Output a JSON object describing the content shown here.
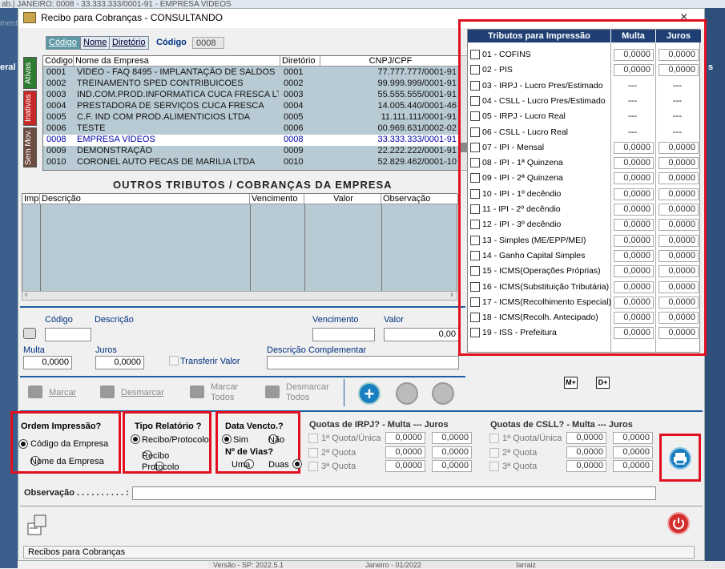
{
  "background": {
    "strip_text": "ab.| JANEIRO: 0008 - 33.333.333/0001-91 - EMPRESA VÍDEOS",
    "left_label": "eral",
    "left_label2": "mento",
    "right_label": "s"
  },
  "window": {
    "title": "Recibo para Cobranças - CONSULTANDO",
    "close_symbol": "×"
  },
  "tabs": [
    {
      "label": "Código"
    },
    {
      "label": "Nome"
    },
    {
      "label": "Diretório"
    }
  ],
  "codigo": {
    "label": "Código",
    "value": "0008"
  },
  "side_tabs": [
    {
      "label": "Ativas",
      "color": "#2e7d32"
    },
    {
      "label": "Inativas",
      "color": "#c62828"
    },
    {
      "label": "Sem Mov.",
      "color": "#6d4c41"
    }
  ],
  "company_grid": {
    "headers": [
      "Código",
      "Nome da Empresa",
      "Diretório",
      "CNPJ/CPF"
    ],
    "rows": [
      {
        "codigo": "0001",
        "nome": "VÍDEO - FAQ 8495 - IMPLANTAÇÃO DE SALDOS",
        "dir": "0001",
        "cnpj": "77.777.777/0001-91"
      },
      {
        "codigo": "0002",
        "nome": "TREINAMENTO SPED CONTRIBUICOES",
        "dir": "0002",
        "cnpj": "99.999.999/0001-91"
      },
      {
        "codigo": "0003",
        "nome": "IND.COM.PROD.INFORMATICA CUCA FRESCA LTD",
        "dir": "0003",
        "cnpj": "55.555.555/0001-91"
      },
      {
        "codigo": "0004",
        "nome": "PRESTADORA DE SERVIÇOS CUCA FRESCA",
        "dir": "0004",
        "cnpj": "14.005.440/0001-46"
      },
      {
        "codigo": "0005",
        "nome": "C.F. IND COM PROD.ALIMENTICIOS LTDA",
        "dir": "0005",
        "cnpj": "11.111.111/0001-91"
      },
      {
        "codigo": "0006",
        "nome": "TESTE",
        "dir": "0006",
        "cnpj": "00.969.631/0002-02"
      },
      {
        "codigo": "0008",
        "nome": "EMPRESA VÍDEOS",
        "dir": "0008",
        "cnpj": "33.333.333/0001-91"
      },
      {
        "codigo": "0009",
        "nome": "DEMONSTRAÇÃO",
        "dir": "0009",
        "cnpj": "22.222.222/0001-91"
      },
      {
        "codigo": "0010",
        "nome": "CORONEL AUTO PECAS DE MARILIA LTDA",
        "dir": "0010",
        "cnpj": "52.829.462/0001-10"
      }
    ],
    "selected_index": 6
  },
  "outros": {
    "title": "OUTROS  TRIBUTOS / COBRANÇAS  DA  EMPRESA",
    "headers": [
      "Imp.",
      "Descrição",
      "Vencimento",
      "Valor",
      "Observação"
    ]
  },
  "form": {
    "codigo_label": "Código",
    "descricao_label": "Descrição",
    "vencimento_label": "Vencimento",
    "valor_label": "Valor",
    "valor_value": "0,00",
    "multa_label": "Multa",
    "multa_value": "0,0000",
    "juros_label": "Juros",
    "juros_value": "0,0000",
    "transferir_label": "Transferir Valor",
    "desc_comp_label": "Descrição Complementar"
  },
  "actions": {
    "marcar": "Marcar",
    "desmarcar": "Desmarcar",
    "marcar_todos_1": "Marcar",
    "marcar_todos_2": "Todos",
    "desmarcar_todos_1": "Desmarcar",
    "desmarcar_todos_2": "Todos",
    "add_symbol": "+"
  },
  "ordem": {
    "title": "Ordem Impressão?",
    "options": [
      "Código da Empresa",
      "Nome da Empresa"
    ],
    "selected": 0
  },
  "tipo": {
    "title": "Tipo Relatório ?",
    "options": [
      "Recibo/Protocolo",
      "Recibo",
      "Protocolo"
    ],
    "selected": 0
  },
  "data_vencto": {
    "title": "Data Vencto.?",
    "options": [
      "Sim",
      "Não"
    ],
    "selected": 0,
    "vias_title": "Nº de Vias?",
    "vias_options": [
      "Uma",
      "Duas"
    ],
    "vias_selected": 1
  },
  "irpj": {
    "title": "Quotas de IRPJ? -  Multa  ---  Juros",
    "rows": [
      {
        "label": "1ª Quota/Única",
        "multa": "0,0000",
        "juros": "0,0000"
      },
      {
        "label": "2ª Quota",
        "multa": "0,0000",
        "juros": "0,0000"
      },
      {
        "label": "3ª Quota",
        "multa": "0,0000",
        "juros": "0,0000"
      }
    ]
  },
  "csll": {
    "title": "Quotas de CSLL? - Multa  --- Juros",
    "rows": [
      {
        "label": "1ª Quota/Única",
        "multa": "0,0000",
        "juros": "0,0000"
      },
      {
        "label": "2ª Quota",
        "multa": "0,0000",
        "juros": "0,0000"
      },
      {
        "label": "3ª Quota",
        "multa": "0,0000",
        "juros": "0,0000"
      }
    ]
  },
  "observacao": {
    "label": "Observação . . . . . . . . . . :"
  },
  "status": {
    "text": "Recibos para Cobranças"
  },
  "bottom_strip": [
    "Versão - SP: 2022.5.1",
    "Janeiro - 01/2022",
    "Iarraiz"
  ],
  "tributos": {
    "headers": [
      "Tributos para Impressão",
      "Multa",
      "Juros"
    ],
    "rows": [
      {
        "label": "01 - COFINS",
        "multa": "0,0000",
        "juros": "0,0000"
      },
      {
        "label": "02 - PIS",
        "multa": "0,0000",
        "juros": "0,0000"
      },
      {
        "label": "03 - IRPJ   -  Lucro Pres/Estimado",
        "multa": "---",
        "juros": "---"
      },
      {
        "label": "04 - CSLL - Lucro Pres/Estimado",
        "multa": "---",
        "juros": "---"
      },
      {
        "label": "05 - IRPJ   -  Lucro Real",
        "multa": "---",
        "juros": "---"
      },
      {
        "label": "06 - CSLL - Lucro Real",
        "multa": "---",
        "juros": "---"
      },
      {
        "label": "07 - IPI  -  Mensal",
        "multa": "0,0000",
        "juros": "0,0000"
      },
      {
        "label": "08 - IPI  -  1ª Quinzena",
        "multa": "0,0000",
        "juros": "0,0000"
      },
      {
        "label": "09 - IPI  -  2ª Quinzena",
        "multa": "0,0000",
        "juros": "0,0000"
      },
      {
        "label": "10 - IPI  -  1º decêndio",
        "multa": "0,0000",
        "juros": "0,0000"
      },
      {
        "label": "11 - IPI  -  2º decêndio",
        "multa": "0,0000",
        "juros": "0,0000"
      },
      {
        "label": "12 - IPI  -  3º decêndio",
        "multa": "0,0000",
        "juros": "0,0000"
      },
      {
        "label": "13 - Simples (ME/EPP/MEI)",
        "multa": "0,0000",
        "juros": "0,0000"
      },
      {
        "label": "14 - Ganho Capital Simples",
        "multa": "0,0000",
        "juros": "0,0000"
      },
      {
        "label": "15 - ICMS(Operações Próprias)",
        "multa": "0,0000",
        "juros": "0,0000"
      },
      {
        "label": "16 - ICMS(Substituição Tributária)",
        "multa": "0,0000",
        "juros": "0,0000"
      },
      {
        "label": "17 - ICMS(Recolhimento Especial)",
        "multa": "0,0000",
        "juros": "0,0000"
      },
      {
        "label": "18 - ICMS(Recolh. Antecipado)",
        "multa": "0,0000",
        "juros": "0,0000"
      },
      {
        "label": "19 - ISS - Prefeitura",
        "multa": "0,0000",
        "juros": "0,0000"
      }
    ]
  },
  "m_button": "M+",
  "d_button": "D+",
  "colors": {
    "highlight_red": "#e01020",
    "header_navy": "#1f3f74",
    "grid_bg": "#b8cad3",
    "print_blue": "#1a7fc0",
    "power_red": "#d32f2f"
  }
}
